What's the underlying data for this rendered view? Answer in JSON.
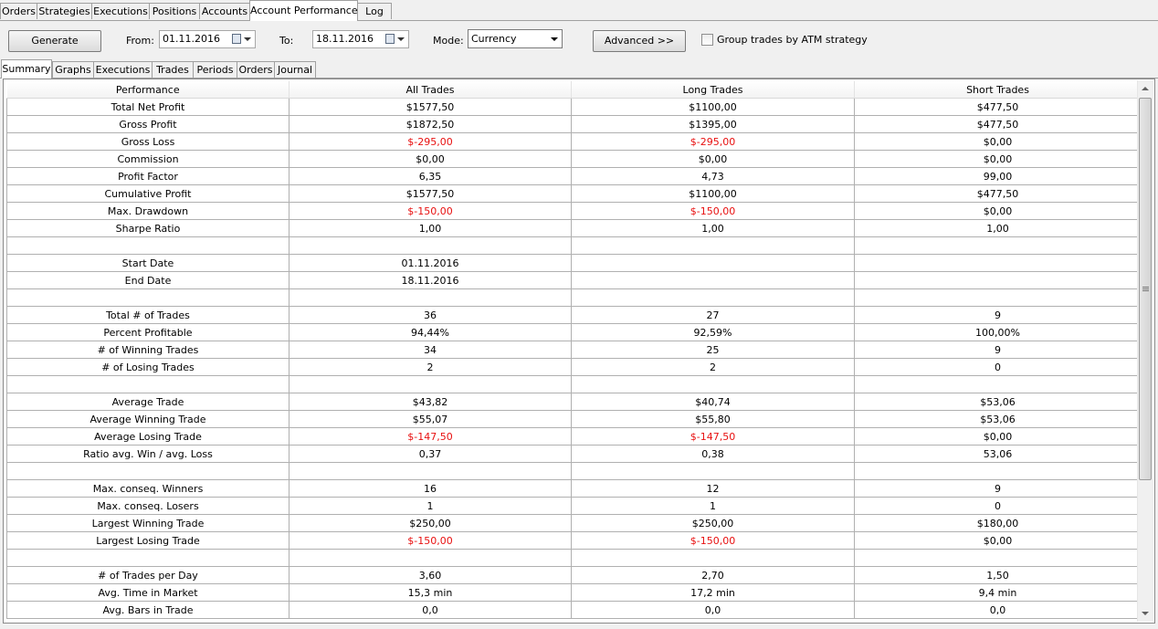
{
  "main_tabs": [
    {
      "label": "Orders",
      "active": false
    },
    {
      "label": "Strategies",
      "active": false
    },
    {
      "label": "Executions",
      "active": false
    },
    {
      "label": "Positions",
      "active": false
    },
    {
      "label": "Accounts",
      "active": false
    },
    {
      "label": "Account Performance",
      "active": true
    },
    {
      "label": "Log",
      "active": false
    }
  ],
  "toolbar": {
    "generate_label": "Generate",
    "from_label": "From:",
    "from_value": "01.11.2016",
    "to_label": "To:",
    "to_value": "18.11.2016",
    "mode_label": "Mode:",
    "mode_value": "Currency",
    "advanced_label": "Advanced >>",
    "group_checkbox_label": "Group trades by ATM strategy",
    "group_checked": false
  },
  "sub_tabs": [
    {
      "label": "Summary",
      "active": true
    },
    {
      "label": "Graphs",
      "active": false
    },
    {
      "label": "Executions",
      "active": false
    },
    {
      "label": "Trades",
      "active": false
    },
    {
      "label": "Periods",
      "active": false
    },
    {
      "label": "Orders",
      "active": false
    },
    {
      "label": "Journal",
      "active": false
    }
  ],
  "table": {
    "headers": [
      "Performance",
      "All Trades",
      "Long Trades",
      "Short Trades"
    ],
    "rows": [
      [
        "Total Net Profit",
        "$1577,50",
        "$1100,00",
        "$477,50"
      ],
      [
        "Gross Profit",
        "$1872,50",
        "$1395,00",
        "$477,50"
      ],
      [
        "Gross Loss",
        "$-295,00",
        "$-295,00",
        "$0,00"
      ],
      [
        "Commission",
        "$0,00",
        "$0,00",
        "$0,00"
      ],
      [
        "Profit Factor",
        "6,35",
        "4,73",
        "99,00"
      ],
      [
        "Cumulative Profit",
        "$1577,50",
        "$1100,00",
        "$477,50"
      ],
      [
        "Max. Drawdown",
        "$-150,00",
        "$-150,00",
        "$0,00"
      ],
      [
        "Sharpe Ratio",
        "1,00",
        "1,00",
        "1,00"
      ],
      [
        "",
        "",
        "",
        ""
      ],
      [
        "Start Date",
        "01.11.2016",
        "",
        ""
      ],
      [
        "End Date",
        "18.11.2016",
        "",
        ""
      ],
      [
        "",
        "",
        "",
        ""
      ],
      [
        "Total # of Trades",
        "36",
        "27",
        "9"
      ],
      [
        "Percent Profitable",
        "94,44%",
        "92,59%",
        "100,00%"
      ],
      [
        "# of Winning Trades",
        "34",
        "25",
        "9"
      ],
      [
        "# of Losing Trades",
        "2",
        "2",
        "0"
      ],
      [
        "",
        "",
        "",
        ""
      ],
      [
        "Average Trade",
        "$43,82",
        "$40,74",
        "$53,06"
      ],
      [
        "Average Winning Trade",
        "$55,07",
        "$55,80",
        "$53,06"
      ],
      [
        "Average Losing Trade",
        "$-147,50",
        "$-147,50",
        "$0,00"
      ],
      [
        "Ratio avg. Win / avg. Loss",
        "0,37",
        "0,38",
        "53,06"
      ],
      [
        "",
        "",
        "",
        ""
      ],
      [
        "Max. conseq. Winners",
        "16",
        "12",
        "9"
      ],
      [
        "Max. conseq. Losers",
        "1",
        "1",
        "0"
      ],
      [
        "Largest Winning Trade",
        "$250,00",
        "$250,00",
        "$180,00"
      ],
      [
        "Largest Losing Trade",
        "$-150,00",
        "$-150,00",
        "$0,00"
      ],
      [
        "",
        "",
        "",
        ""
      ],
      [
        "# of Trades per Day",
        "3,60",
        "2,70",
        "1,50"
      ],
      [
        "Avg. Time in Market",
        "15,3 min",
        "17,2 min",
        "9,4 min"
      ],
      [
        "Avg. Bars in Trade",
        "0,0",
        "0,0",
        "0,0"
      ]
    ]
  },
  "colors": {
    "negative": "#e81010"
  }
}
